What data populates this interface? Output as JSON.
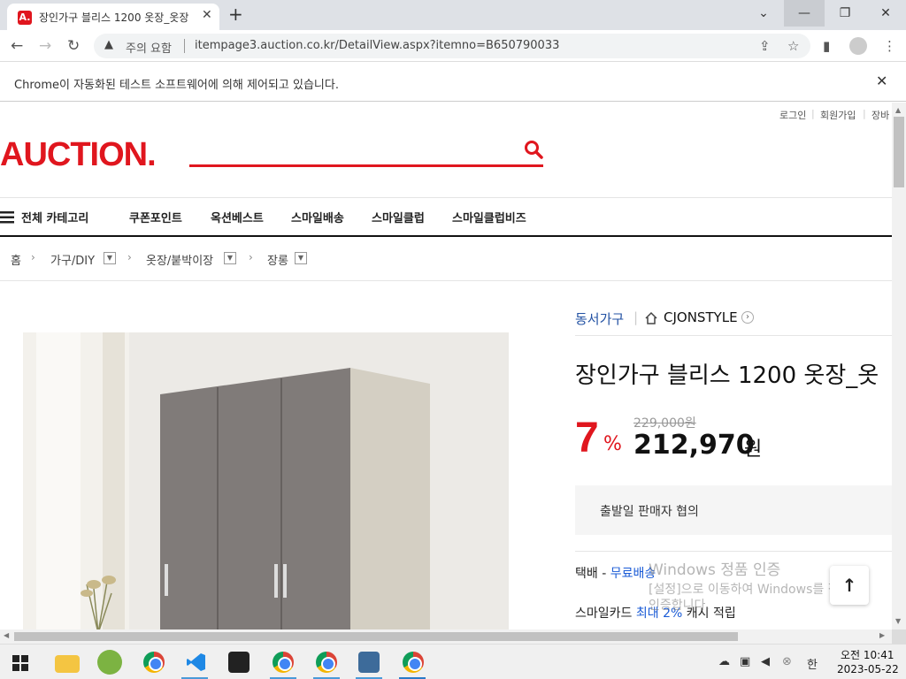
{
  "browser": {
    "tab_title": "장인가구 블리스 1200 옷장_옷장",
    "tab_favicon": "A.",
    "security_label": "주의 요함",
    "url": "itempage3.auction.co.kr/DetailView.aspx?itemno=B650790033",
    "infobar_message": "Chrome이 자동화된 테스트 소프트웨어에 의해 제어되고 있습니다."
  },
  "header": {
    "links": [
      "로그인",
      "회원가입",
      "장바"
    ],
    "logo": "AUCTION."
  },
  "nav": {
    "all_categories": "전체 카테고리",
    "items": [
      "쿠폰포인트",
      "옥션베스트",
      "스마일배송",
      "스마일클럽",
      "스마일클럽비즈"
    ]
  },
  "breadcrumb": {
    "home": "홈",
    "levels": [
      "가구/DIY",
      "옷장/붙박이장",
      "장롱"
    ]
  },
  "product": {
    "seller": "동서가구",
    "store": "CJONSTYLE",
    "title": "장인가구 블리스 1200 옷장_옷",
    "discount": "7",
    "discount_unit": "%",
    "original_price": "229,000원",
    "price": "212,970",
    "price_unit": "원",
    "shipping_info": "출발일 판매자 협의",
    "delivery_label": "택배 - ",
    "delivery_value": "무료배송",
    "card_label": "스마일카드 ",
    "card_value": "최대 2%",
    "card_suffix": " 캐시 적립"
  },
  "watermark": {
    "line1": "Windows 정품 인증",
    "line2": "[설정]으로 이동하여 Windows를 정품",
    "line3": "인증합니다."
  },
  "taskbar": {
    "ime": "한",
    "time": "오전 10:41",
    "date": "2023-05-22"
  },
  "colors": {
    "brand": "#e0161e",
    "link_blue": "#1a5bd6",
    "seller_blue": "#2251a3"
  }
}
